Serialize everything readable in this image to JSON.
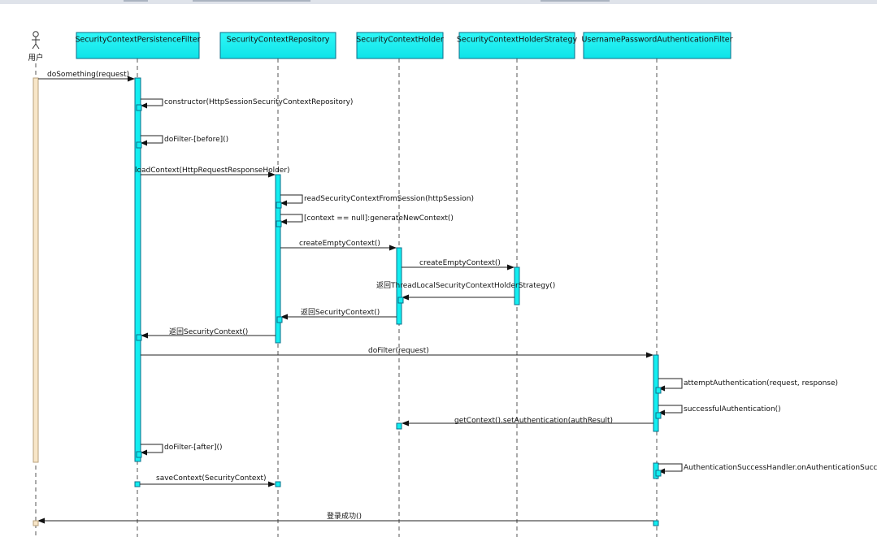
{
  "actor": {
    "label": "用户"
  },
  "participants": [
    {
      "label": "SecurityContextPersistenceFilter"
    },
    {
      "label": "SecurityContextRepository"
    },
    {
      "label": "SecurityContextHolder"
    },
    {
      "label": "SecurityContextHolderStrategy"
    },
    {
      "label": "UsernamePasswordAuthenticationFilter"
    }
  ],
  "messages": [
    {
      "label": "doSomething(request)"
    },
    {
      "label": "constructor(HttpSessionSecurityContextRepository)"
    },
    {
      "label": "doFilter-[before]()"
    },
    {
      "label": "loadContext(HttpRequestResponseHolder)"
    },
    {
      "label": "readSecurityContextFromSession(httpSession)"
    },
    {
      "label": "[context == null]:generateNewContext()"
    },
    {
      "label": "createEmptyContext()"
    },
    {
      "label": "createEmptyContext()"
    },
    {
      "label": "返回ThreadLocalSecurityContextHolderStrategy()"
    },
    {
      "label": "返回SecurityContext()"
    },
    {
      "label": "返回SecurityContext()"
    },
    {
      "label": "doFilter(request)"
    },
    {
      "label": "attemptAuthentication(request, response)"
    },
    {
      "label": "successfulAuthentication()"
    },
    {
      "label": "getContext().setAuthentication(authResult)"
    },
    {
      "label": "doFilter-[after]()"
    },
    {
      "label": "AuthenticationSuccessHandler.onAuthenticationSuccess"
    },
    {
      "label": "saveContext(SecurityContext)"
    },
    {
      "label": "登录成功()"
    }
  ],
  "colors": {
    "participant_fill": "#13eef0",
    "participant_border": "#0b6f8a",
    "actor_activation": "#f8e6c8"
  }
}
